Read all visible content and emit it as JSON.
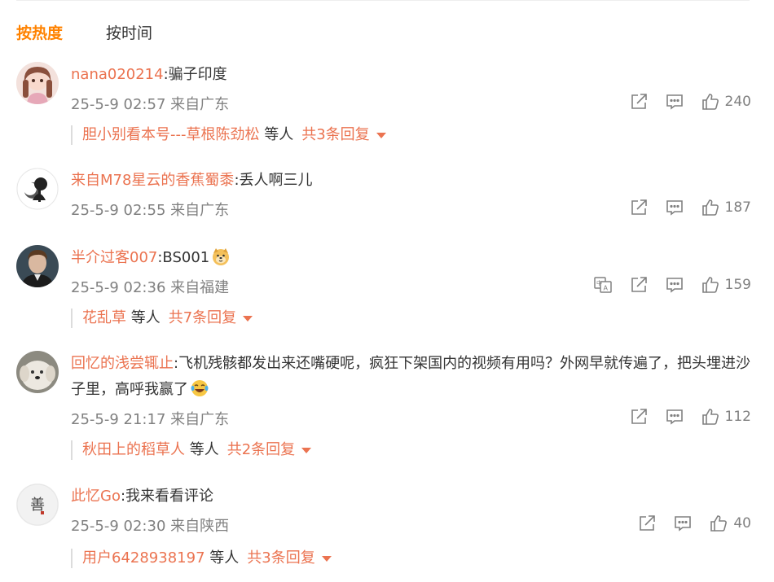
{
  "tabs": [
    {
      "label": "按热度",
      "active": true
    },
    {
      "label": "按时间",
      "active": false
    }
  ],
  "colors": {
    "accent": "#ff8200",
    "username": "#eb7350",
    "meta": "#808080"
  },
  "comments": [
    {
      "user": "nana020214",
      "text": ":骗子印度",
      "time": "25-5-9 02:57",
      "location": "来自广东",
      "likes": "240",
      "replies": {
        "names": "胆小别看本号---草根陈劲松",
        "suffix": "等人",
        "total": "共3条回复"
      }
    },
    {
      "user": "来自M78星云的香蕉蜀黍",
      "text": ":丢人啊三儿",
      "time": "25-5-9 02:55",
      "location": "来自广东",
      "likes": "187"
    },
    {
      "user": "半介过客007",
      "text": ":BS001",
      "emoji": "doge-emoji",
      "time": "25-5-9 02:36",
      "location": "来自福建",
      "likes": "159",
      "has_translate": true,
      "replies": {
        "names": "花乱草",
        "suffix": "等人",
        "total": "共7条回复"
      }
    },
    {
      "user": "回忆的浅尝辄止",
      "text": ":飞机残骸都发出来还嘴硬呢，疯狂下架国内的视频有用吗？外网早就传遍了，把头埋进沙子里，高呼我赢了",
      "emoji": "laughing-tears-emoji",
      "time": "25-5-9 21:17",
      "location": "来自广东",
      "likes": "112",
      "replies": {
        "names": "秋田上的稻草人",
        "suffix": "等人",
        "total": "共2条回复"
      }
    },
    {
      "user": "此忆Go",
      "text": ":我来看看评论",
      "time": "25-5-9 02:30",
      "location": "来自陕西",
      "likes": "40",
      "replies": {
        "names": "用户6428938197",
        "suffix": "等人",
        "total": "共3条回复"
      }
    }
  ]
}
